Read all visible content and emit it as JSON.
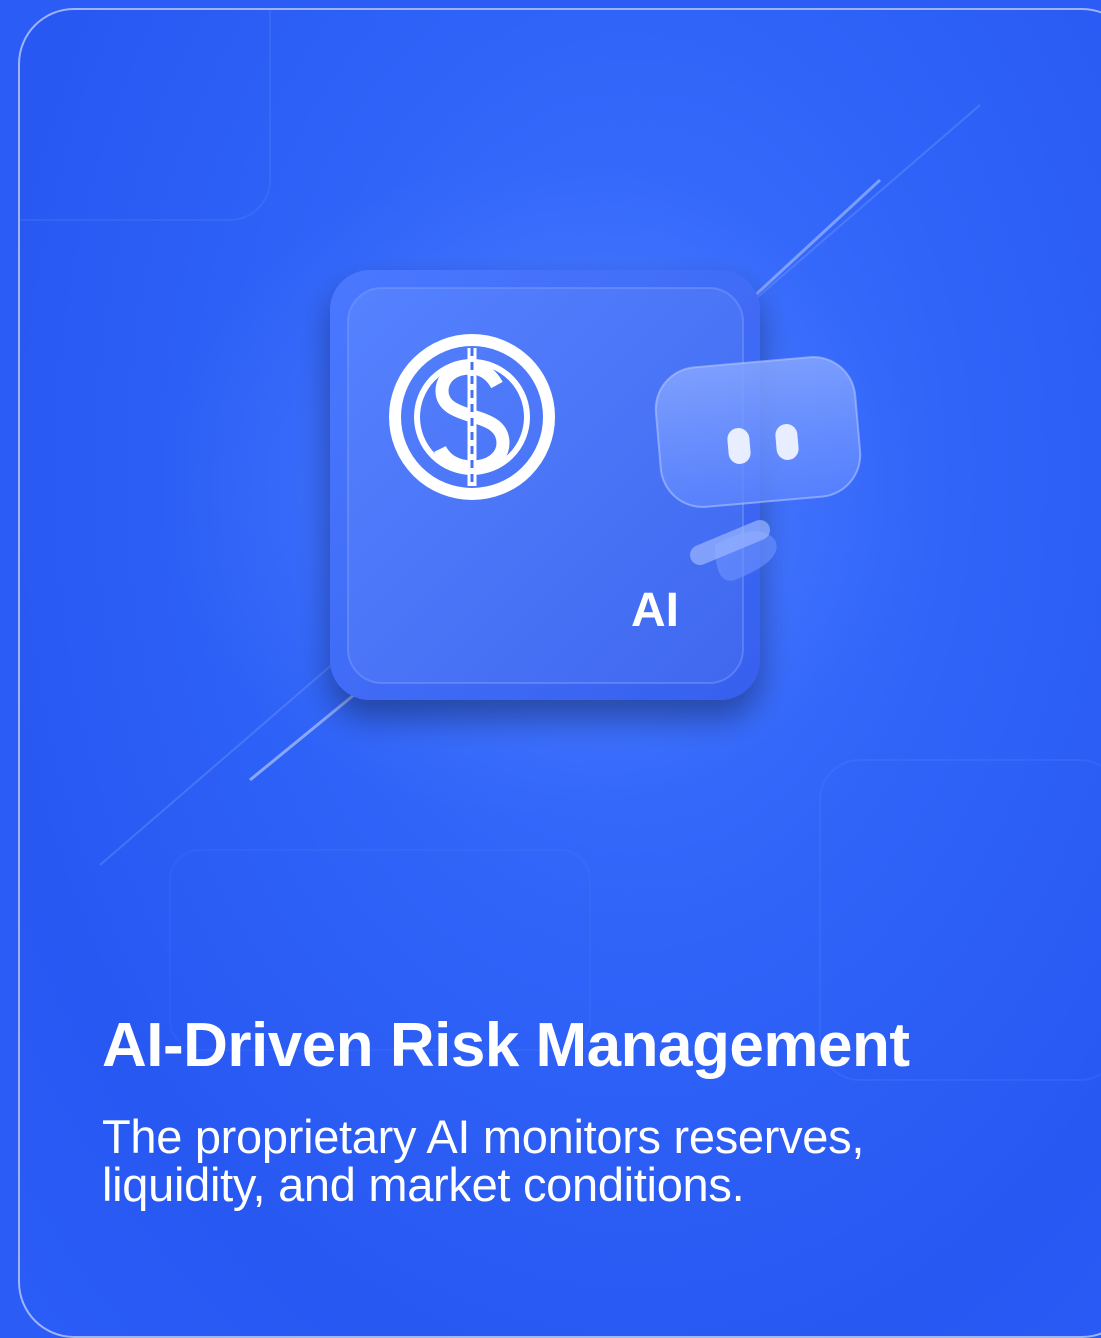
{
  "card": {
    "title": "AI-Driven Risk Management",
    "description_lines": [
      "The proprietary AI monitors reserves,",
      "liquidity, and market conditions."
    ]
  },
  "illustration": {
    "badge_label": "AI",
    "icons": [
      "dollar-coin-icon",
      "robot-chat-icon"
    ]
  },
  "colors": {
    "background": "#2c5cf6",
    "tile": "#4470f5",
    "text": "#ffffff"
  }
}
